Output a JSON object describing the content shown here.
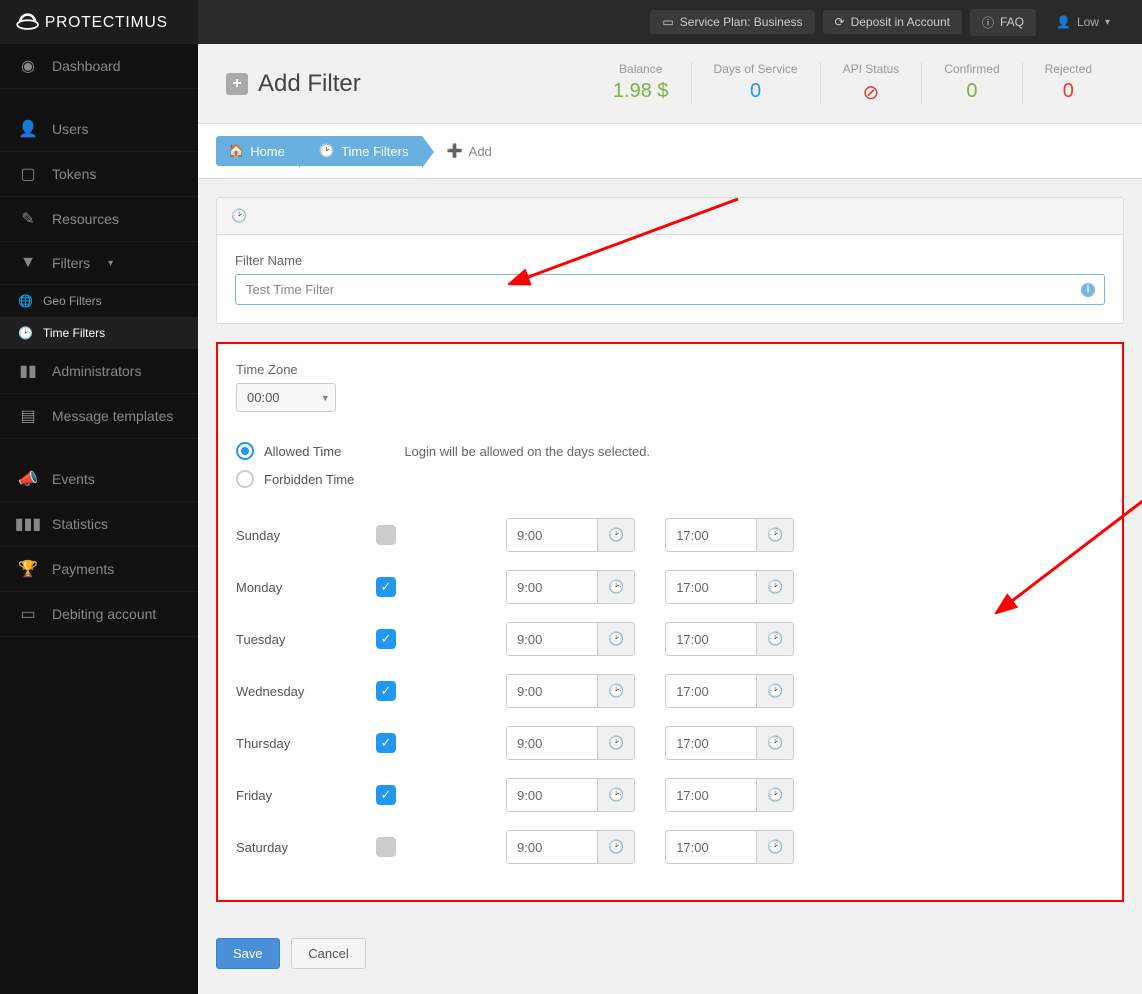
{
  "brand": "PROTECTIMUS",
  "topbar": {
    "service_plan": "Service Plan: Business",
    "deposit": "Deposit in Account",
    "faq": "FAQ",
    "user": "Low"
  },
  "sidebar": {
    "dashboard": "Dashboard",
    "users": "Users",
    "tokens": "Tokens",
    "resources": "Resources",
    "filters": "Filters",
    "geo_filters": "Geo Filters",
    "time_filters": "Time Filters",
    "administrators": "Administrators",
    "message_templates": "Message templates",
    "events": "Events",
    "statistics": "Statistics",
    "payments": "Payments",
    "debiting": "Debiting account"
  },
  "header": {
    "title": "Add Filter",
    "stats": {
      "balance_label": "Balance",
      "balance_value": "1.98 $",
      "days_label": "Days of Service",
      "days_value": "0",
      "api_label": "API Status",
      "api_value": "⊘",
      "confirmed_label": "Confirmed",
      "confirmed_value": "0",
      "rejected_label": "Rejected",
      "rejected_value": "0"
    }
  },
  "breadcrumb": {
    "home": "Home",
    "time_filters": "Time Filters",
    "add": "Add"
  },
  "form": {
    "filter_name_label": "Filter Name",
    "filter_name_value": "Test Time Filter",
    "timezone_label": "Time Zone",
    "timezone_value": "00:00",
    "allowed_label": "Allowed Time",
    "forbidden_label": "Forbidden Time",
    "hint": "Login will be allowed on the days selected.",
    "days": [
      {
        "name": "Sunday",
        "checked": false,
        "from": "9:00",
        "to": "17:00"
      },
      {
        "name": "Monday",
        "checked": true,
        "from": "9:00",
        "to": "17:00"
      },
      {
        "name": "Tuesday",
        "checked": true,
        "from": "9:00",
        "to": "17:00"
      },
      {
        "name": "Wednesday",
        "checked": true,
        "from": "9:00",
        "to": "17:00"
      },
      {
        "name": "Thursday",
        "checked": true,
        "from": "9:00",
        "to": "17:00"
      },
      {
        "name": "Friday",
        "checked": true,
        "from": "9:00",
        "to": "17:00"
      },
      {
        "name": "Saturday",
        "checked": false,
        "from": "9:00",
        "to": "17:00"
      }
    ],
    "save": "Save",
    "cancel": "Cancel"
  }
}
